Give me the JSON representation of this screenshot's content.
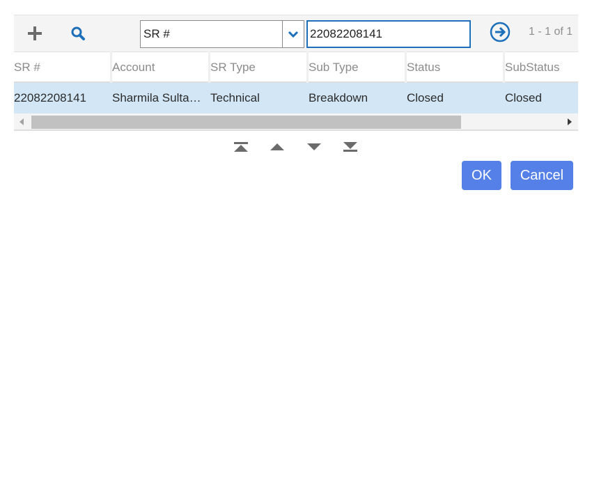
{
  "toolbar": {
    "add_icon": "plus-icon",
    "search_icon": "search-icon",
    "field_select_value": "SR #",
    "search_value": "22082208141",
    "go_icon": "arrow-right-circle-icon",
    "pager_text": "1 - 1 of 1"
  },
  "grid": {
    "columns": [
      "SR #",
      "Account",
      "SR Type",
      "Sub Type",
      "Status",
      "SubStatus"
    ],
    "rows": [
      [
        "22082208141",
        "Sharmila Sultana",
        "Technical",
        "Breakdown",
        "Closed",
        "Closed"
      ]
    ]
  },
  "nav": {
    "first_icon": "first-record-icon",
    "prev_icon": "previous-record-icon",
    "next_icon": "next-record-icon",
    "last_icon": "last-record-icon"
  },
  "buttons": {
    "ok_label": "OK",
    "cancel_label": "Cancel"
  },
  "colors": {
    "accent": "#1c6fb8",
    "selected_row": "#d2e6f5",
    "button": "#5580e8"
  }
}
